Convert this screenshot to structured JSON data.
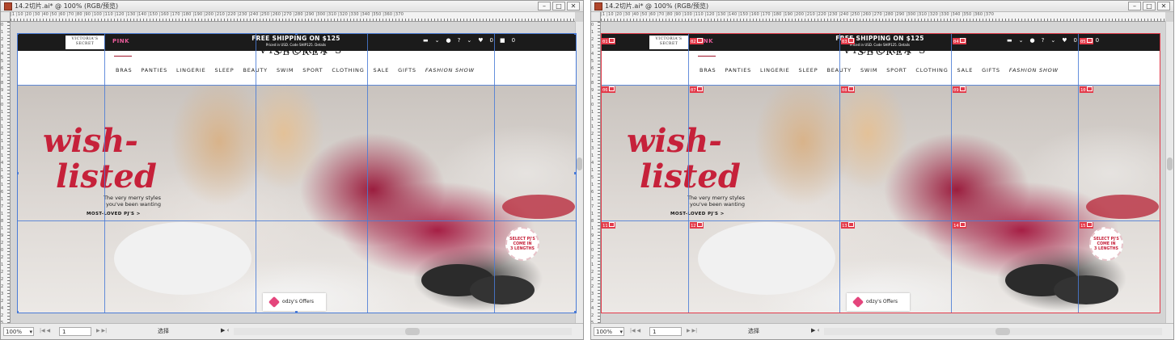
{
  "windows": [
    {
      "title": "14.2切片.ai* @ 100% (RGB/预览)",
      "zoom": "100%",
      "page": "1",
      "mode": "选择",
      "show_slices": false
    },
    {
      "title": "14.2切片.ai* @ 100% (RGB/预览)",
      "zoom": "100%",
      "page": "1",
      "mode": "选择",
      "show_slices": true
    }
  ],
  "window_buttons": {
    "minimize": "–",
    "maximize": "□",
    "close": "✕"
  },
  "ruler_numbers": "|1  |10  |20  |30  |40  |50  |60  |70  |80  |90  |100 |110 |120 |130 |140 |150 |160 |170 |180 |190 |200 |210 |220 |230 |240 |250 |260 |270 |280 |290 |300 |310 |320 |330 |340 |350 |360 |370",
  "ruler_numbers_v": "0 1 2 3 4 5 6 7 8 9 1 0 1 1 1 2 1 3 1 4 1 5 1 6 1 7 1 8 1 9 2 0 2 1 2 2 2 3 2 4 2 5 2 6 2 7 2 8",
  "webpage": {
    "logo_text": "VICTORIA'S SECRET",
    "pink_label": "PINK",
    "promo_main": "FREE SHIPPING ON $125",
    "promo_sub": "Priced in USD. Code SHIP125. Details",
    "icons": [
      "flag-icon",
      "chevron-down-icon",
      "user-icon",
      "help-icon",
      "heart-icon",
      "bag-icon"
    ],
    "heart_count": "0",
    "bag_count": "0",
    "brand_partial": "VICTORIA'S SECRET",
    "nav": [
      "BRAS",
      "PANTIES",
      "LINGERIE",
      "SLEEP",
      "BEAUTY",
      "SWIM",
      "SPORT",
      "CLOTHING",
      "SALE",
      "GIFTS",
      "FASHION SHOW"
    ],
    "hero_word1": "wish-",
    "hero_word2": "listed",
    "hero_sub_line1": "The very merry styles",
    "hero_sub_line2": "you've been wanting",
    "hero_cta": "MOST-LOVED PJ'S >",
    "badge_line1": "SELECT PJ'S",
    "badge_line2": "COME IN",
    "badge_line3": "3 LENGTHS",
    "offers_label": "odzy's Offers"
  },
  "slices": [
    "01",
    "02",
    "03",
    "04",
    "05",
    "06",
    "07",
    "08",
    "09",
    "10",
    "11",
    "12",
    "13",
    "14",
    "15"
  ],
  "colors": {
    "accent_red": "#c6213a",
    "guide_blue": "#4a7bd6",
    "slice_red": "#e33a4a",
    "topbar": "#1b1b1b",
    "pink": "#e95c9a"
  }
}
